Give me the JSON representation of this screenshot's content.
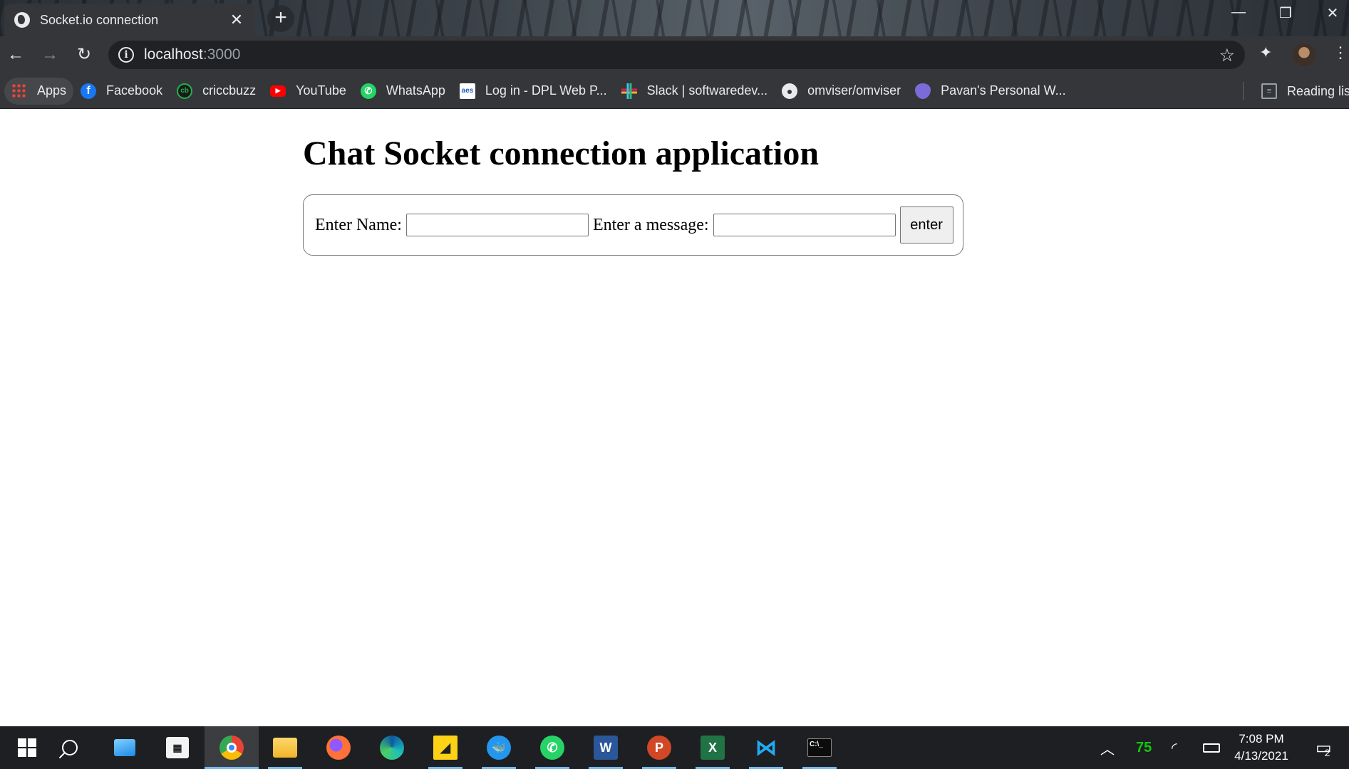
{
  "browser": {
    "tab": {
      "title": "Socket.io connection",
      "close": "✕"
    },
    "new_tab": "+",
    "window_controls": {
      "minimize": "—",
      "restore": "❐",
      "close": "✕"
    },
    "nav": {
      "back": "←",
      "forward": "→",
      "reload": "↻"
    },
    "address": {
      "info": "i",
      "host": "localhost",
      "port": ":3000",
      "bookmark_icon": "star-icon"
    },
    "bookmarks": [
      {
        "label": "Apps",
        "icon": "apps-grid-icon"
      },
      {
        "label": "Facebook",
        "icon": "facebook-icon"
      },
      {
        "label": "criccbuzz",
        "icon": "cricbuzz-icon"
      },
      {
        "label": "YouTube",
        "icon": "youtube-icon"
      },
      {
        "label": "WhatsApp",
        "icon": "whatsapp-icon"
      },
      {
        "label": "Log in - DPL Web P...",
        "icon": "aes-icon"
      },
      {
        "label": "Slack | softwaredev...",
        "icon": "slack-icon"
      },
      {
        "label": "omviser/omviser",
        "icon": "github-icon"
      },
      {
        "label": "Pavan's Personal W...",
        "icon": "eye-icon"
      }
    ],
    "reading_list": "Reading list"
  },
  "page": {
    "heading": "Chat Socket connection application",
    "form": {
      "name_label": "Enter Name:",
      "name_value": "",
      "message_label": "Enter a message:",
      "message_value": "",
      "submit_label": "enter"
    }
  },
  "taskbar": {
    "apps": [
      "start",
      "search",
      "this-pc",
      "store",
      "chrome",
      "file-explorer",
      "firefox",
      "edge",
      "sticky-notes",
      "docker",
      "whatsapp",
      "word",
      "powerpoint",
      "excel",
      "vscode",
      "terminal"
    ],
    "tray": {
      "battery_percent": "75"
    },
    "clock": {
      "time": "7:08 PM",
      "date": "4/13/2021"
    },
    "notifications": "2",
    "colors": {
      "accent": "#76b9ed",
      "battery": "#16c60c"
    }
  }
}
